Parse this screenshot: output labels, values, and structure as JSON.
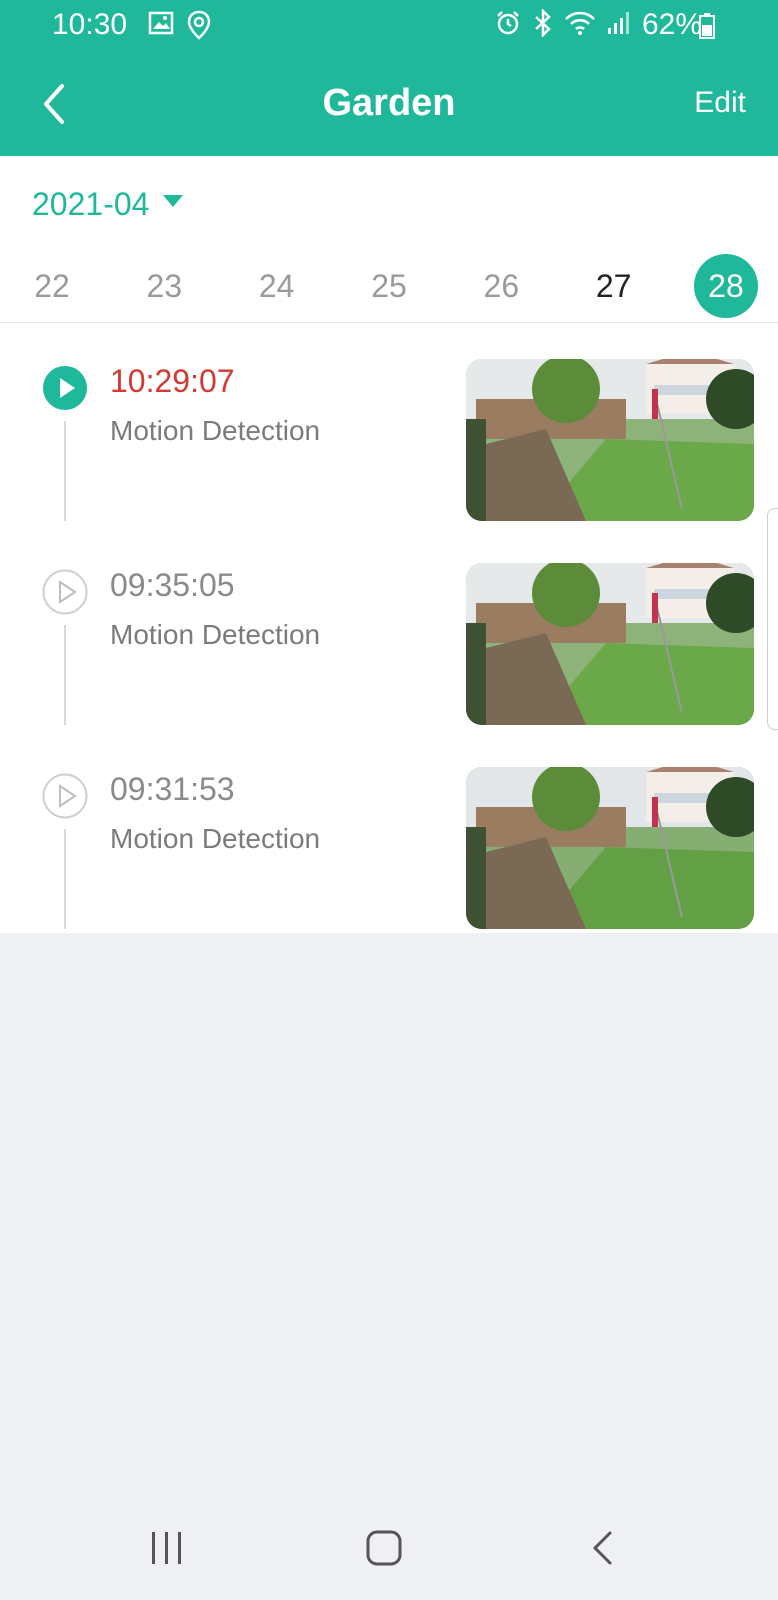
{
  "status_bar": {
    "time": "10:30",
    "battery": "62%",
    "icons": [
      "gallery-icon",
      "location-icon",
      "alarm-icon",
      "bluetooth-icon",
      "wifi-icon",
      "signal-icon",
      "battery-icon"
    ]
  },
  "header": {
    "title": "Garden",
    "edit_label": "Edit",
    "back_icon": "chevron-left-icon"
  },
  "date_picker": {
    "month": "2021-04",
    "days": [
      {
        "label": "22",
        "has_recordings": false,
        "selected": false
      },
      {
        "label": "23",
        "has_recordings": false,
        "selected": false
      },
      {
        "label": "24",
        "has_recordings": false,
        "selected": false
      },
      {
        "label": "25",
        "has_recordings": false,
        "selected": false
      },
      {
        "label": "26",
        "has_recordings": false,
        "selected": false
      },
      {
        "label": "27",
        "has_recordings": true,
        "selected": false
      },
      {
        "label": "28",
        "has_recordings": true,
        "selected": true
      }
    ]
  },
  "events": [
    {
      "time": "10:29:07",
      "type": "Motion Detection",
      "active": true
    },
    {
      "time": "09:35:05",
      "type": "Motion Detection",
      "active": false
    },
    {
      "time": "09:31:53",
      "type": "Motion Detection",
      "active": false
    }
  ],
  "colors": {
    "accent": "#1fb89a",
    "active_time": "#d23b34",
    "background": "#eff0f3"
  },
  "nav_bar": {
    "icons": [
      "recent-apps-icon",
      "home-icon",
      "back-icon"
    ]
  }
}
